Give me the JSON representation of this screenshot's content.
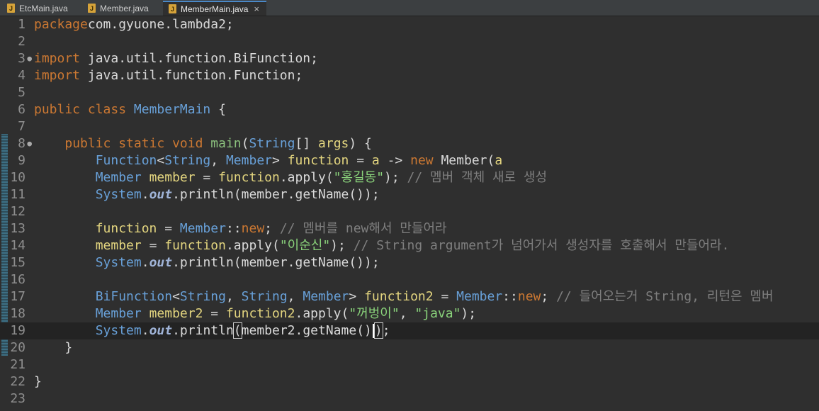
{
  "tabs": [
    {
      "label": "EtcMain.java",
      "active": false
    },
    {
      "label": "Member.java",
      "active": false
    },
    {
      "label": "MemberMain.java",
      "active": true
    }
  ],
  "java_icon_glyph": "J",
  "close_glyph": "×",
  "lines": [
    {
      "n": "1",
      "tokens": [
        [
          "kw",
          "package"
        ],
        [
          "",
          "com.gyuone.lambda2;"
        ]
      ]
    },
    {
      "n": "2",
      "tokens": []
    },
    {
      "n": "3",
      "fold": true,
      "tokens": [
        [
          "kw",
          "import"
        ],
        [
          "",
          " java.util.function.BiFunction;"
        ]
      ]
    },
    {
      "n": "4",
      "tokens": [
        [
          "kw",
          "import"
        ],
        [
          "",
          " java.util.function.Function;"
        ]
      ]
    },
    {
      "n": "5",
      "tokens": []
    },
    {
      "n": "6",
      "tokens": [
        [
          "kw",
          "public class "
        ],
        [
          "type",
          "MemberMain"
        ],
        [
          "",
          " {"
        ]
      ]
    },
    {
      "n": "7",
      "tokens": []
    },
    {
      "n": "8",
      "fold": true,
      "tokens": [
        [
          "",
          "    "
        ],
        [
          "kw",
          "public static void "
        ],
        [
          "mth",
          "main"
        ],
        [
          "",
          "("
        ],
        [
          "type",
          "String"
        ],
        [
          "",
          "[] "
        ],
        [
          "var",
          "args"
        ],
        [
          "",
          ") {"
        ]
      ]
    },
    {
      "n": "9",
      "tokens": [
        [
          "",
          "        "
        ],
        [
          "type",
          "Function"
        ],
        [
          "",
          "<"
        ],
        [
          "type",
          "String"
        ],
        [
          "",
          ", "
        ],
        [
          "type",
          "Member"
        ],
        [
          "",
          "> "
        ],
        [
          "var",
          "function"
        ],
        [
          "",
          " = "
        ],
        [
          "var",
          "a"
        ],
        [
          "",
          " -> "
        ],
        [
          "kw",
          "new "
        ],
        [
          "",
          "Member("
        ],
        [
          "var",
          "a"
        ],
        [
          ");"
        ]
      ]
    },
    {
      "n": "10",
      "tokens": [
        [
          "",
          "        "
        ],
        [
          "type",
          "Member "
        ],
        [
          "var",
          "member"
        ],
        [
          "",
          " = "
        ],
        [
          "var",
          "function"
        ],
        [
          "",
          ".apply("
        ],
        [
          "str",
          "\"홍길동\""
        ],
        [
          "",
          "); "
        ],
        [
          "cm",
          "// 멤버 객체 새로 생성"
        ]
      ]
    },
    {
      "n": "11",
      "tokens": [
        [
          "",
          "        "
        ],
        [
          "type",
          "System"
        ],
        [
          "",
          "."
        ],
        [
          "fld",
          "out"
        ],
        [
          "",
          ".println(member.getName());"
        ]
      ]
    },
    {
      "n": "12",
      "tokens": []
    },
    {
      "n": "13",
      "tokens": [
        [
          "",
          "        "
        ],
        [
          "var",
          "function"
        ],
        [
          "",
          " = "
        ],
        [
          "type",
          "Member"
        ],
        [
          "",
          "::"
        ],
        [
          "kw",
          "new"
        ],
        [
          "",
          "; "
        ],
        [
          "cm",
          "// 멤버를 new해서 만들어라"
        ]
      ]
    },
    {
      "n": "14",
      "tokens": [
        [
          "",
          "        "
        ],
        [
          "var",
          "member"
        ],
        [
          "",
          " = "
        ],
        [
          "var",
          "function"
        ],
        [
          "",
          ".apply("
        ],
        [
          "str",
          "\"이순신\""
        ],
        [
          "",
          "); "
        ],
        [
          "cm",
          "// String argument가 넘어가서 생성자를 호출해서 만들어라."
        ]
      ]
    },
    {
      "n": "15",
      "tokens": [
        [
          "",
          "        "
        ],
        [
          "type",
          "System"
        ],
        [
          "",
          "."
        ],
        [
          "fld",
          "out"
        ],
        [
          "",
          ".println(member.getName());"
        ]
      ]
    },
    {
      "n": "16",
      "tokens": []
    },
    {
      "n": "17",
      "tokens": [
        [
          "",
          "        "
        ],
        [
          "type",
          "BiFunction"
        ],
        [
          "",
          "<"
        ],
        [
          "type",
          "String"
        ],
        [
          "",
          ", "
        ],
        [
          "type",
          "String"
        ],
        [
          "",
          ", "
        ],
        [
          "type",
          "Member"
        ],
        [
          "",
          "> "
        ],
        [
          "var",
          "function2"
        ],
        [
          "",
          " = "
        ],
        [
          "type",
          "Member"
        ],
        [
          "",
          "::"
        ],
        [
          "kw",
          "new"
        ],
        [
          "",
          "; "
        ],
        [
          "cm",
          "// 들어오는거 String, 리턴은 멤버"
        ]
      ]
    },
    {
      "n": "18",
      "tokens": [
        [
          "",
          "        "
        ],
        [
          "type",
          "Member "
        ],
        [
          "var",
          "member2"
        ],
        [
          "",
          " = "
        ],
        [
          "var",
          "function2"
        ],
        [
          "",
          ".apply("
        ],
        [
          "str",
          "\"꺼벙이\""
        ],
        [
          "",
          ", "
        ],
        [
          "str",
          "\"java\""
        ],
        [
          "",
          ");"
        ]
      ]
    },
    {
      "n": "19",
      "current": true,
      "tokens": [
        [
          "",
          "        "
        ],
        [
          "type",
          "System"
        ],
        [
          "",
          "."
        ],
        [
          "fld",
          "out"
        ],
        [
          "",
          ".println"
        ],
        [
          "box",
          "("
        ],
        [
          "",
          "member2.getName()"
        ],
        [
          "caret",
          ""
        ],
        [
          "box",
          ")"
        ],
        [
          "",
          ";"
        ]
      ]
    },
    {
      "n": "20",
      "tokens": [
        [
          "",
          "    }"
        ]
      ]
    },
    {
      "n": "21",
      "tokens": []
    },
    {
      "n": "22",
      "tokens": [
        [
          "",
          "}"
        ]
      ]
    },
    {
      "n": "23",
      "tokens": []
    }
  ]
}
